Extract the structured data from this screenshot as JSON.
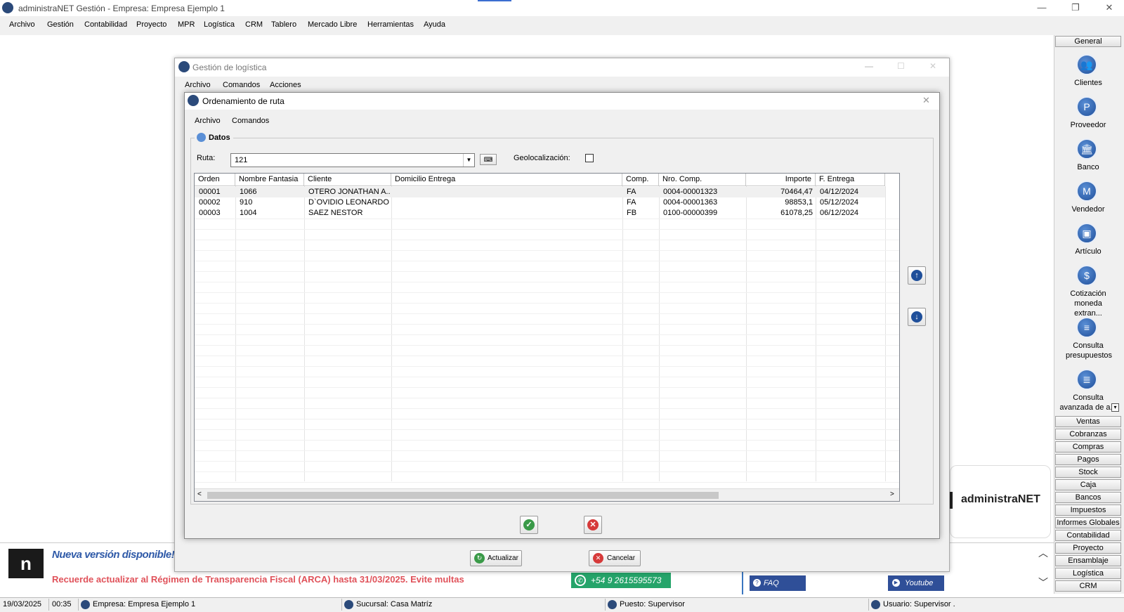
{
  "app": {
    "title": "administraNET Gestión - Empresa: Empresa Ejemplo 1"
  },
  "menu": [
    "Archivo",
    "Gestión",
    "Contabilidad",
    "Proyecto",
    "MPR",
    "Logística",
    "CRM",
    "Tablero",
    "Mercado Libre",
    "Herramientas",
    "Ayuda"
  ],
  "sidebar": {
    "header": "General",
    "items": [
      "Clientes",
      "Proveedor",
      "Banco",
      "Vendedor",
      "Artículo",
      "Cotización moneda extran...",
      "Consulta presupuestos",
      "Consulta avanzada de a..."
    ],
    "sections": [
      "Ventas",
      "Cobranzas",
      "Compras",
      "Pagos",
      "Stock",
      "Caja",
      "Bancos",
      "Impuestos",
      "Informes Globales",
      "Contabilidad",
      "Proyecto",
      "Ensamblaje",
      "Logística",
      "CRM"
    ]
  },
  "bgwindow": {
    "title": "Gestión de logística",
    "menu": [
      "Archivo",
      "Comandos",
      "Acciones"
    ],
    "update_label": "Actualizar",
    "cancel_label": "Cancelar",
    "brand": "administraNET"
  },
  "dialog": {
    "title": "Ordenamiento de ruta",
    "menu": [
      "Archivo",
      "Comandos"
    ],
    "group_label": "Datos",
    "ruta_label": "Ruta:",
    "ruta_value": "121",
    "geo_label": "Geolocalización:"
  },
  "table": {
    "headers": [
      "Orden",
      "Nombre Fantasia",
      "Cliente",
      "Domicilio Entrega",
      "Comp.",
      "Nro. Comp.",
      "Importe",
      "F. Entrega"
    ],
    "rows": [
      [
        "00001",
        "1066",
        "OTERO JONATHAN A...",
        "",
        "FA",
        "0004-00001323",
        "70464,47",
        "04/12/2024"
      ],
      [
        "00002",
        "910",
        "D`OVIDIO LEONARDO",
        "",
        "FA",
        "0004-00001363",
        "98853,1",
        "05/12/2024"
      ],
      [
        "00003",
        "1004",
        "SAEZ NESTOR",
        "",
        "FB",
        "0100-00000399",
        "61078,25",
        "06/12/2024"
      ]
    ]
  },
  "news": {
    "headline": "Nueva versión disponible!",
    "message": "Recuerde actualizar al Régimen de Transparencia Fiscal (ARCA) hasta 31/03/2025. Evite multas",
    "whatsapp": "+54 9 2615595573",
    "faq": "FAQ",
    "youtube": "Youtube"
  },
  "status": {
    "date": "19/03/2025",
    "time": "00:35",
    "empresa": "Empresa: Empresa Ejemplo 1",
    "sucursal": "Sucursal: Casa Matríz",
    "puesto": "Puesto: Supervisor",
    "usuario": "Usuario: Supervisor ."
  },
  "colors": {
    "accent": "#1f4f9a",
    "news_red": "#e0525a",
    "whatsapp": "#25a46a",
    "link_blue": "#2f5aa8"
  }
}
